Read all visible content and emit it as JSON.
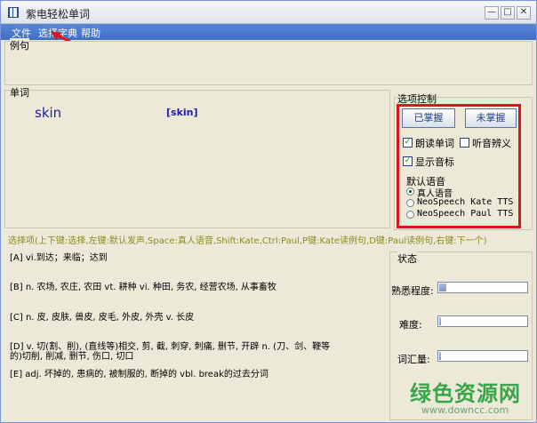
{
  "window": {
    "title": "紫电轻松单词",
    "minimize_glyph": "—",
    "maximize_glyph": "□",
    "close_glyph": "✕"
  },
  "menu": {
    "items": [
      {
        "label": "文件"
      },
      {
        "label": "选择字典"
      },
      {
        "label": "帮助"
      }
    ]
  },
  "example": {
    "label": "例句"
  },
  "word_panel": {
    "label": "单词",
    "word": "skin",
    "phonetic": "[skin]"
  },
  "options": {
    "label": "选项控制",
    "mastered_button": "已掌握",
    "unmastered_button": "未掌握",
    "read_word": {
      "label": "朗读单词",
      "checked": true
    },
    "listen_meaning": {
      "label": "听音辨义",
      "checked": false
    },
    "show_phonetic": {
      "label": "显示音标",
      "checked": true
    },
    "voice_label": "默认语音",
    "voices": [
      {
        "label": "真人语音",
        "selected": true
      },
      {
        "label": "NeoSpeech Kate TTS",
        "selected": false
      },
      {
        "label": "NeoSpeech Paul TTS",
        "selected": false
      }
    ]
  },
  "hint": "选择项(上下键:选择,左键:默认发声,Space:真人语音,Shift:Kate,Ctrl:Paul,P键:Kate读例句,D键:Paul读例句,右键:下一个)",
  "answers": [
    {
      "text": "[A]  vi.到达；来临；达到"
    },
    {
      "text": "[B]  n. 农场, 农庄, 农田 vt. 耕种 vi. 种田, 务农, 经营农场, 从事畜牧"
    },
    {
      "text": "[C]  n. 皮, 皮肤, 兽皮, 皮毛, 外皮, 外壳 v. 长皮"
    },
    {
      "text": "[D]  v. 切(割、削), (直线等)相交, 剪, 截, 刺穿, 刺痛, 删节, 开辟 n. (刀、剑、鞭等"
    },
    {
      "text": "的)切削, 削减, 删节, 伤口, 切口"
    },
    {
      "text": "[E]  adj. 坏掉的, 患病的, 被制服的, 断掉的 vbl. break的过去分词"
    }
  ],
  "status": {
    "label": "状态",
    "familiarity": {
      "label": "熟悉程度:",
      "value": 0.08
    },
    "difficulty": {
      "label": "难度:",
      "value": 0.02
    },
    "vocabulary": {
      "label": "词汇量:",
      "value": 0.02
    }
  },
  "watermark": {
    "title": "绿色资源网",
    "url": "www.downcc.com"
  },
  "colors": {
    "menubar": "#3e6ec6",
    "word_text": "#1e1ea8",
    "highlight": "#d9161c",
    "hint_text": "#8b8b1a",
    "watermark": "#3aa64a"
  }
}
